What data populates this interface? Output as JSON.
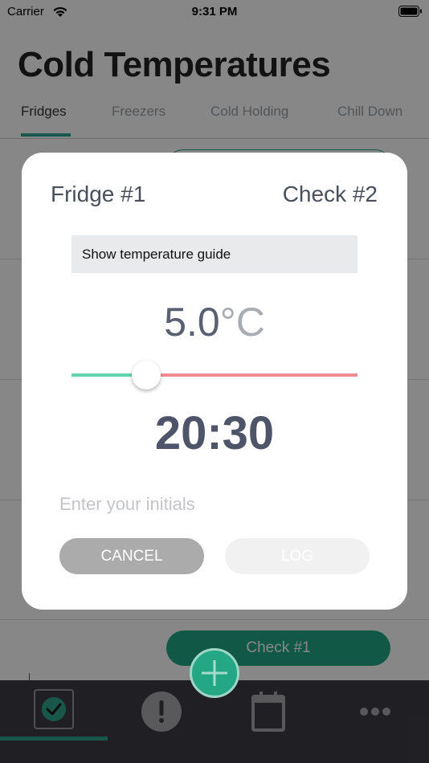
{
  "status_bar": {
    "carrier": "Carrier",
    "time": "9:31 PM"
  },
  "header": {
    "title": "Cold Temperatures"
  },
  "tabs": [
    {
      "label": "Fridges",
      "active": true
    },
    {
      "label": "Freezers",
      "active": false
    },
    {
      "label": "Cold Holding",
      "active": false
    },
    {
      "label": "Chill Down",
      "active": false
    }
  ],
  "background": {
    "check_button_label": "Check #1"
  },
  "modal": {
    "unit_name": "Fridge #1",
    "check_name": "Check #2",
    "guide_button_label": "Show temperature guide",
    "temperature_value": "5.0",
    "temperature_unit": "°C",
    "slider_fraction": 0.26,
    "time": "20:30",
    "initials_placeholder": "Enter your initials",
    "initials_value": "",
    "cancel_label": "CANCEL",
    "log_label": "LOG"
  },
  "tab_bar": {
    "items": [
      {
        "name": "checks",
        "icon": "checkmark-circle-icon",
        "active": true
      },
      {
        "name": "alerts",
        "icon": "exclamation-icon",
        "active": false
      },
      {
        "name": "add",
        "icon": "plus-icon",
        "active": false
      },
      {
        "name": "calendar",
        "icon": "calendar-icon",
        "active": false
      },
      {
        "name": "more",
        "icon": "ellipsis-icon",
        "active": false
      }
    ]
  },
  "colors": {
    "accent": "#2fa58a",
    "slider_low": "#62d5b0",
    "slider_high": "#f08b92",
    "tab_bar": "#3d3d45",
    "cancel_button": "#ababab"
  }
}
